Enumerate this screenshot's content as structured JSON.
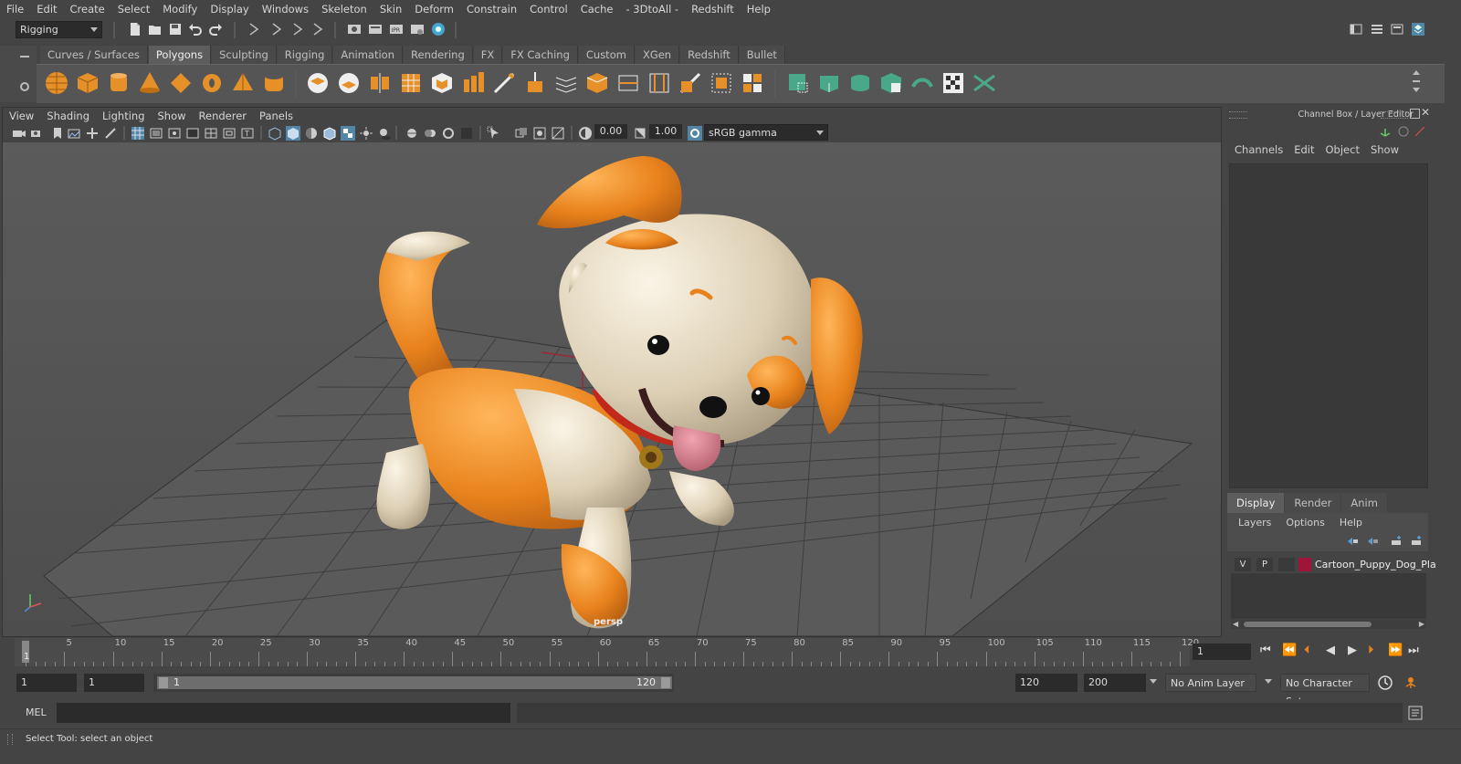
{
  "menubar": {
    "items": [
      "File",
      "Edit",
      "Create",
      "Select",
      "Modify",
      "Display",
      "Windows",
      "Skeleton",
      "Skin",
      "Deform",
      "Constrain",
      "Control",
      "Cache",
      "- 3DtoAll -",
      "Redshift",
      "Help"
    ]
  },
  "statusline": {
    "menu_set": "Rigging"
  },
  "shelf": {
    "tabs": [
      "Curves / Surfaces",
      "Polygons",
      "Sculpting",
      "Rigging",
      "Animation",
      "Rendering",
      "FX",
      "FX Caching",
      "Custom",
      "XGen",
      "Redshift",
      "Bullet"
    ],
    "active_tab": "Polygons"
  },
  "viewport": {
    "menu": [
      "View",
      "Shading",
      "Lighting",
      "Show",
      "Renderer",
      "Panels"
    ],
    "exposure": "0.00",
    "gamma": "1.00",
    "color_space": "sRGB gamma",
    "camera_label": "persp"
  },
  "channel_box": {
    "title": "Channel Box / Layer Editor",
    "menu": [
      "Channels",
      "Edit",
      "Object",
      "Show"
    ]
  },
  "layer_editor": {
    "tabs": [
      "Display",
      "Render",
      "Anim"
    ],
    "active_tab": "Display",
    "menu": [
      "Layers",
      "Options",
      "Help"
    ],
    "layer": {
      "visible": "V",
      "playback": "P",
      "name": "Cartoon_Puppy_Dog_Pla",
      "color": "#a0143a"
    }
  },
  "timeline": {
    "tick_labels": [
      "5",
      "10",
      "15",
      "20",
      "25",
      "30",
      "35",
      "40",
      "45",
      "50",
      "55",
      "60",
      "65",
      "70",
      "75",
      "80",
      "85",
      "90",
      "95",
      "100",
      "105",
      "110",
      "115",
      "120"
    ],
    "start_marker": "1",
    "current_frame": "1"
  },
  "range": {
    "start_time": "1",
    "playback_start": "1",
    "slider_start": "1",
    "slider_end": "120",
    "playback_end": "120",
    "end_time": "200",
    "anim_layer": "No Anim Layer",
    "character_set": "No Character Set"
  },
  "command_line": {
    "label": "MEL"
  },
  "help_line": {
    "text": "Select Tool: select an object"
  },
  "colors": {
    "accent_blue": "#5285a6",
    "shelf_green": "#4aa88a",
    "puppy_orange": "#e8821c",
    "puppy_cream": "#ded2b8"
  }
}
